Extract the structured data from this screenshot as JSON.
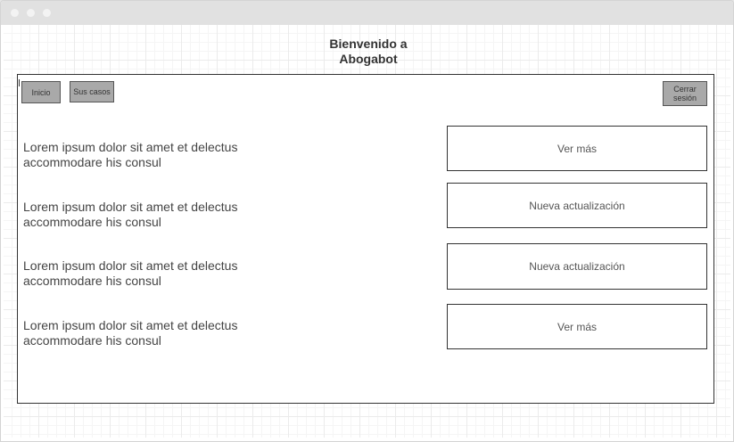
{
  "page": {
    "heading": "Bienvenido a Abogabot"
  },
  "nav": {
    "home_label": "Inicio",
    "cases_label": "Sus casos",
    "logout_label": "Cerrar sesión"
  },
  "cases": [
    {
      "text": "Lorem ipsum dolor sit amet et delectus accommodare his consul",
      "action": "Ver más"
    },
    {
      "text": "Lorem ipsum dolor sit amet et delectus accommodare his consul",
      "action": "Nueva actualización"
    },
    {
      "text": "Lorem ipsum dolor sit amet et delectus accommodare his consul",
      "action": "Nueva actualización"
    },
    {
      "text": "Lorem ipsum dolor sit amet et delectus accommodare his consul",
      "action": "Ver más"
    }
  ],
  "colors": {
    "titlebar": "#e1e1e1",
    "nav_button_fill": "#a9a9a9",
    "frame_border": "#333333"
  }
}
